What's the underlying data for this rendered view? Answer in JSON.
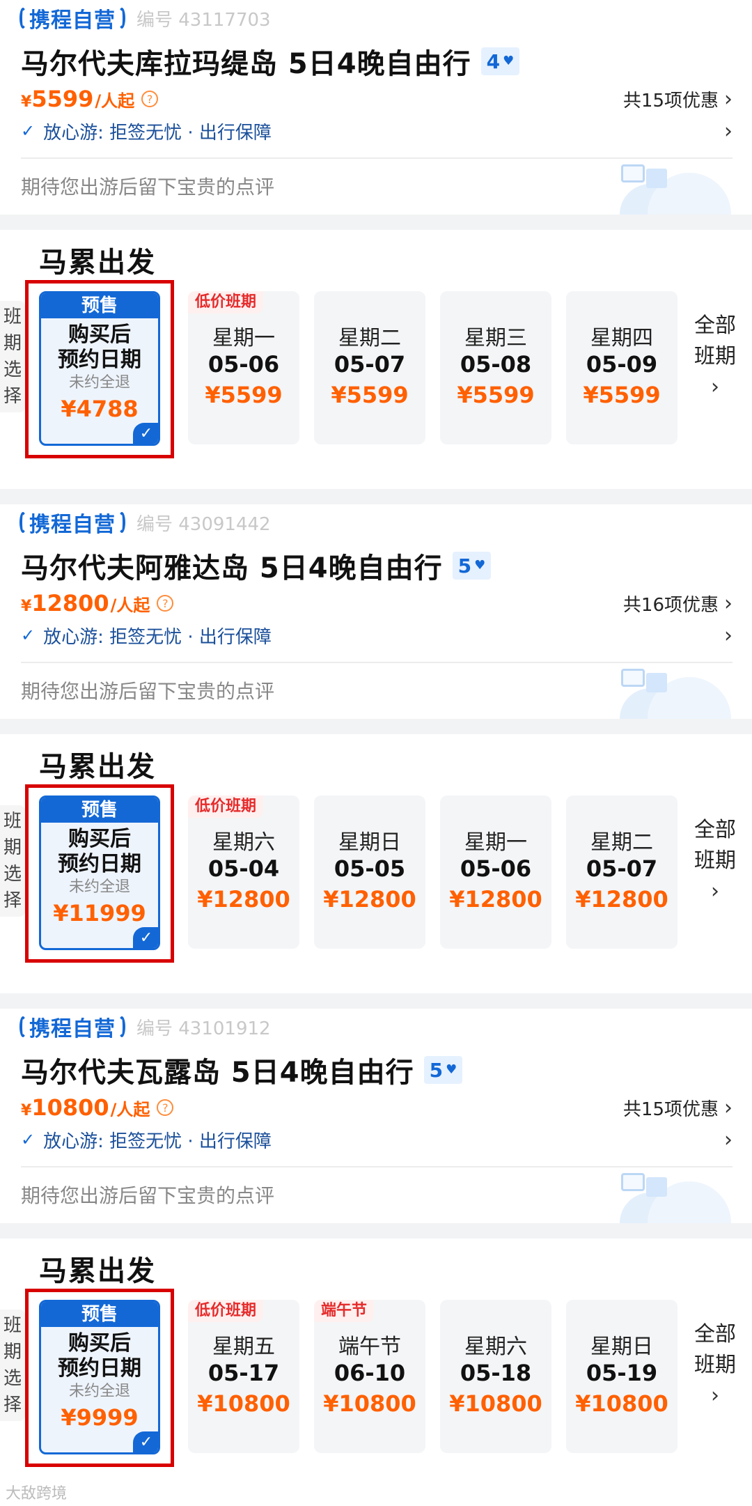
{
  "products": [
    {
      "brand": "携程自营",
      "code": "编号 43117703",
      "title": "马尔代夫库拉玛缇岛 5日4晚自由行",
      "rating": "4",
      "price_cur": "¥",
      "price_num": "5599",
      "price_unit": "/人起",
      "offers": "共15项优惠",
      "assurance": "放心游: 拒签无忧 · 出行保障",
      "review": "期待您出游后留下宝贵的点评"
    },
    {
      "brand": "携程自营",
      "code": "编号 43091442",
      "title": "马尔代夫阿雅达岛 5日4晚自由行",
      "rating": "5",
      "price_cur": "¥",
      "price_num": "12800",
      "price_unit": "/人起",
      "offers": "共16项优惠",
      "assurance": "放心游: 拒签无忧 · 出行保障",
      "review": "期待您出游后留下宝贵的点评"
    },
    {
      "brand": "携程自营",
      "code": "编号 43101912",
      "title": "马尔代夫瓦露岛 5日4晚自由行",
      "rating": "5",
      "price_cur": "¥",
      "price_num": "10800",
      "price_unit": "/人起",
      "offers": "共15项优惠",
      "assurance": "放心游: 拒签无忧 · 出行保障",
      "review": "期待您出游后留下宝贵的点评"
    }
  ],
  "departures": [
    {
      "title": "马累出发",
      "side": [
        "班",
        "期",
        "选",
        "择"
      ],
      "presale": {
        "tag": "预售",
        "line1": "购买后",
        "line2": "预约日期",
        "note": "未约全退",
        "price": "¥4788"
      },
      "dates": [
        {
          "label": "低价班期",
          "week": "星期一",
          "date": "05-06",
          "price": "¥5599"
        },
        {
          "label": "",
          "week": "星期二",
          "date": "05-07",
          "price": "¥5599"
        },
        {
          "label": "",
          "week": "星期三",
          "date": "05-08",
          "price": "¥5599"
        },
        {
          "label": "",
          "week": "星期四",
          "date": "05-09",
          "price": "¥5599"
        }
      ],
      "all_line1": "全部",
      "all_line2": "班期"
    },
    {
      "title": "马累出发",
      "side": [
        "班",
        "期",
        "选",
        "择"
      ],
      "presale": {
        "tag": "预售",
        "line1": "购买后",
        "line2": "预约日期",
        "note": "未约全退",
        "price": "¥11999"
      },
      "dates": [
        {
          "label": "低价班期",
          "week": "星期六",
          "date": "05-04",
          "price": "¥12800"
        },
        {
          "label": "",
          "week": "星期日",
          "date": "05-05",
          "price": "¥12800"
        },
        {
          "label": "",
          "week": "星期一",
          "date": "05-06",
          "price": "¥12800"
        },
        {
          "label": "",
          "week": "星期二",
          "date": "05-07",
          "price": "¥12800"
        }
      ],
      "all_line1": "全部",
      "all_line2": "班期"
    },
    {
      "title": "马累出发",
      "side": [
        "班",
        "期",
        "选",
        "择"
      ],
      "presale": {
        "tag": "预售",
        "line1": "购买后",
        "line2": "预约日期",
        "note": "未约全退",
        "price": "¥9999"
      },
      "dates": [
        {
          "label": "低价班期",
          "week": "星期五",
          "date": "05-17",
          "price": "¥10800"
        },
        {
          "label": "端午节",
          "week": "端午节",
          "date": "06-10",
          "price": "¥10800"
        },
        {
          "label": "",
          "week": "星期六",
          "date": "05-18",
          "price": "¥10800"
        },
        {
          "label": "",
          "week": "星期日",
          "date": "05-19",
          "price": "¥10800"
        }
      ],
      "all_line1": "全部",
      "all_line2": "班期"
    }
  ],
  "watermark": "大敌跨境"
}
